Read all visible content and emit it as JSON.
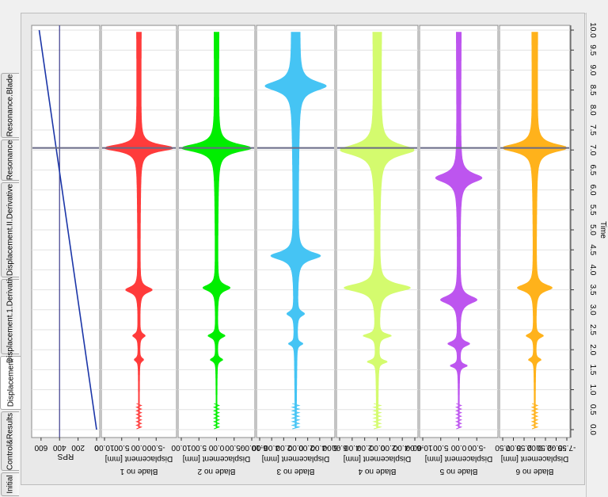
{
  "tabs": [
    {
      "label": "Initial",
      "active": false
    },
    {
      "label": "Control&Results",
      "active": false
    },
    {
      "label": "Displacement",
      "active": true
    },
    {
      "label": "Displacement.1.Derivative",
      "active": false
    },
    {
      "label": "Displacement.II.Derivative",
      "active": false
    },
    {
      "label": "Resonance",
      "active": false
    },
    {
      "label": "Resonance.Blade",
      "active": false
    }
  ],
  "time_axis": {
    "label": "Time",
    "ticks": [
      "0.0",
      "0.5",
      "1.0",
      "1.5",
      "2.0",
      "2.5",
      "3.0",
      "3.5",
      "4.0",
      "4.5",
      "5.0",
      "5.5",
      "6.0",
      "6.5",
      "7.0",
      "7.5",
      "8.0",
      "8.5",
      "9.0",
      "9.5",
      "10.0"
    ],
    "range": [
      0,
      10
    ],
    "cursor_time": 7.05
  },
  "chart_data": [
    {
      "type": "line",
      "name": "rps",
      "title": "",
      "xlabel": "Time",
      "ylabel": "RPS",
      "value_ticks": [
        "600",
        "400",
        "200",
        "0"
      ],
      "range": [
        0,
        650
      ],
      "x": [
        0,
        10
      ],
      "values": [
        0,
        620
      ],
      "color": "#1c36a8",
      "marker_value": 400
    },
    {
      "type": "area",
      "name": "blade1",
      "ylabel": "Displacement [mm]",
      "title": "Blade no 1",
      "value_ticks": [
        "10.00",
        "5.00",
        "0.00",
        "-5.00"
      ],
      "range": [
        -10,
        10
      ],
      "color": "#ff3b3b",
      "peaks": [
        {
          "t": 7.05,
          "amp": 9.8,
          "w": 0.1
        },
        {
          "t": 3.5,
          "amp": 3.6,
          "w": 0.09
        },
        {
          "t": 2.35,
          "amp": 1.6,
          "w": 0.06
        },
        {
          "t": 1.75,
          "amp": 1.2,
          "w": 0.05
        }
      ]
    },
    {
      "type": "area",
      "name": "blade2",
      "ylabel": "Displacement [mm]",
      "title": "Blade no 2",
      "value_ticks": [
        "10.00",
        "5.00",
        "0.00",
        "-5.00",
        "-10.00"
      ],
      "range": [
        -10,
        10
      ],
      "color": "#00ee00",
      "peaks": [
        {
          "t": 7.05,
          "amp": 9.5,
          "w": 0.12
        },
        {
          "t": 3.55,
          "amp": 3.6,
          "w": 0.09
        },
        {
          "t": 2.35,
          "amp": 2.2,
          "w": 0.06
        },
        {
          "t": 1.75,
          "amp": 1.6,
          "w": 0.05
        }
      ]
    },
    {
      "type": "area",
      "name": "blade3",
      "ylabel": "Displacement [mm]",
      "title": "Blade no 3",
      "value_ticks": [
        "6.00",
        "4.00",
        "2.00",
        "0.00",
        "-2.00",
        "-4.00",
        "-6.00"
      ],
      "range": [
        -6,
        6
      ],
      "color": "#45c4f4",
      "peaks": [
        {
          "t": 8.6,
          "amp": 4.5,
          "w": 0.15
        },
        {
          "t": 4.35,
          "amp": 3.8,
          "w": 0.12
        },
        {
          "t": 2.9,
          "amp": 1.2,
          "w": 0.07
        },
        {
          "t": 2.15,
          "amp": 1.0,
          "w": 0.05
        }
      ]
    },
    {
      "type": "area",
      "name": "blade4",
      "ylabel": "Displacement [mm]",
      "title": "Blade no 4",
      "value_ticks": [
        "6.00",
        "4.00",
        "2.00",
        "0.00",
        "-2.00",
        "-4.00",
        "-6.00"
      ],
      "range": [
        -6,
        6
      ],
      "color": "#d4fb6e",
      "peaks": [
        {
          "t": 7.0,
          "amp": 5.5,
          "w": 0.16
        },
        {
          "t": 3.55,
          "amp": 5.0,
          "w": 0.12
        },
        {
          "t": 2.35,
          "amp": 2.0,
          "w": 0.06
        },
        {
          "t": 1.7,
          "amp": 1.4,
          "w": 0.05
        }
      ]
    },
    {
      "type": "area",
      "name": "blade5",
      "ylabel": "Displacement [mm]",
      "title": "Blade no 5",
      "value_ticks": [
        "10.00",
        "5.00",
        "0.00",
        "-5.00"
      ],
      "range": [
        -10,
        10
      ],
      "color": "#bd55ef",
      "peaks": [
        {
          "t": 6.3,
          "amp": 6.0,
          "w": 0.14
        },
        {
          "t": 3.25,
          "amp": 4.8,
          "w": 0.12
        },
        {
          "t": 2.15,
          "amp": 2.8,
          "w": 0.07
        },
        {
          "t": 1.6,
          "amp": 2.2,
          "w": 0.05
        }
      ]
    },
    {
      "type": "area",
      "name": "blade6",
      "ylabel": "Displacement [mm]",
      "title": "Blade no 6",
      "value_ticks": [
        "7.50",
        "5.00",
        "2.50",
        "0.00",
        "-2.50",
        "-5.00",
        "-7.50"
      ],
      "range": [
        -7.5,
        7.5
      ],
      "color": "#ffb21b",
      "peaks": [
        {
          "t": 7.05,
          "amp": 7.3,
          "w": 0.12
        },
        {
          "t": 3.55,
          "amp": 3.8,
          "w": 0.1
        },
        {
          "t": 2.35,
          "amp": 1.8,
          "w": 0.06
        },
        {
          "t": 1.75,
          "amp": 1.3,
          "w": 0.05
        }
      ]
    }
  ]
}
